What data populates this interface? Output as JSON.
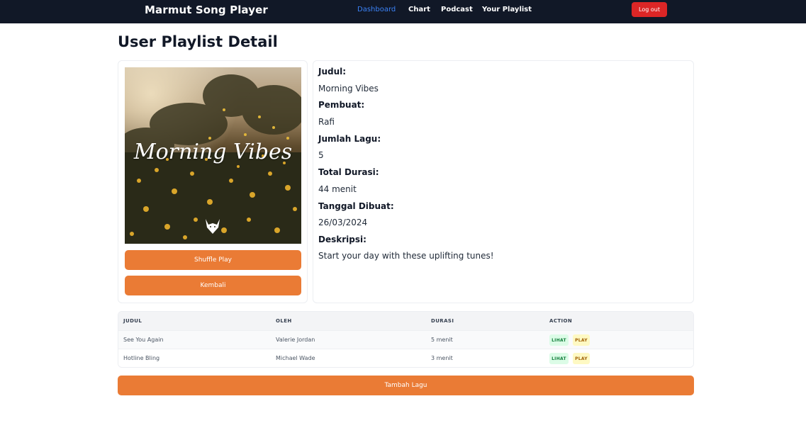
{
  "navbar": {
    "brand": "Marmut Song Player",
    "links": [
      "Dashboard",
      "Chart",
      "Podcast",
      "Your Playlist"
    ],
    "logout_label": "Log out"
  },
  "page": {
    "title": "User Playlist Detail"
  },
  "cover": {
    "text": "Morning Vibes"
  },
  "buttons": {
    "shuffle": "Shuffle Play",
    "back": "Kembali",
    "add_song": "Tambah Lagu"
  },
  "details": [
    {
      "label": "Judul:",
      "value": "Morning Vibes"
    },
    {
      "label": "Pembuat:",
      "value": "Rafi"
    },
    {
      "label": "Jumlah Lagu:",
      "value": "5"
    },
    {
      "label": "Total Durasi:",
      "value": "44 menit"
    },
    {
      "label": "Tanggal Dibuat:",
      "value": "26/03/2024"
    },
    {
      "label": "Deskripsi:",
      "value": "Start your day with these uplifting tunes!"
    }
  ],
  "table": {
    "headers": [
      "JUDUL",
      "OLEH",
      "DURASI",
      "ACTION"
    ],
    "rows": [
      {
        "title": "See You Again",
        "artist": "Valerie Jordan",
        "duration": "5 menit",
        "view": "LIHAT",
        "play": "PLAY"
      },
      {
        "title": "Hotline Bling",
        "artist": "Michael Wade",
        "duration": "3 menit",
        "view": "LIHAT",
        "play": "PLAY"
      }
    ]
  },
  "colors": {
    "navbar": "#111827",
    "active_link": "#3b82f6",
    "accent": "#ea7b35",
    "logout": "#dc2626"
  }
}
